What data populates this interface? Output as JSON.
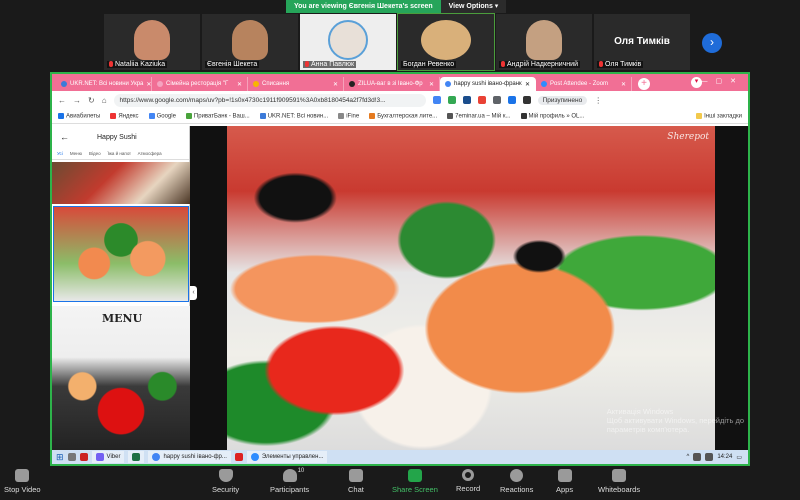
{
  "zoom_banner": {
    "viewing_text": "You are viewing Євгенія Шекета's screen",
    "view_options": "View Options ▾"
  },
  "participants": [
    {
      "name": "Nataliia Kaziuka",
      "muted": true,
      "face_color": "#c98a6b"
    },
    {
      "name": "Євгенія Шекета",
      "muted": false,
      "face_color": "#b7835e"
    },
    {
      "name": "Анна Павлюк",
      "muted": true,
      "face_color": "#e8e0d8"
    },
    {
      "name": "Богдан Ревенко",
      "muted": false,
      "face_color": "#d9b07a",
      "active": true
    },
    {
      "name": "Андрій Надкерничний",
      "muted": true,
      "face_color": "#c4a081"
    },
    {
      "name": "Оля Тимків",
      "muted": true,
      "big_name": "Оля Тимків"
    }
  ],
  "browser": {
    "tabs": [
      {
        "title": "UKR.NET: Всі новини Укра",
        "fav": "#3c7bd9"
      },
      {
        "title": "Сімейна ресторація \"Г",
        "fav": "#f5a3c0"
      },
      {
        "title": "Списання",
        "fav": "#f7b500"
      },
      {
        "title": "ZILUA-ваг в зі Івано-Фр",
        "fav": "#222222"
      },
      {
        "title": "happy sushi івано-франк",
        "fav": "#4285f4",
        "active": true
      },
      {
        "title": "Post Attendee - Zoom",
        "fav": "#2d8cff"
      }
    ],
    "address": "https://www.google.com/maps/uv?pb=!1s0x4730c1911f909591%3A0xb8180454a2f7fd3d!3...",
    "paused_label": "Призупинено",
    "bookmarks": [
      {
        "label": "Авиабилеты",
        "color": "#1a73e8"
      },
      {
        "label": "Яндекс",
        "color": "#e33"
      },
      {
        "label": "Google",
        "color": "#4285f4"
      },
      {
        "label": "ПриватБанк - Ваш...",
        "color": "#49a33b"
      },
      {
        "label": "UKR.NET: Всі новин...",
        "color": "#3c7bd9"
      },
      {
        "label": "iFine",
        "color": "#888"
      },
      {
        "label": "Бухгалтерская лите...",
        "color": "#e57b20"
      },
      {
        "label": "7eminar.ua – Мій к...",
        "color": "#555"
      },
      {
        "label": "Мій профиль » OL...",
        "color": "#333"
      }
    ],
    "other_bookmarks": "Інші закладки"
  },
  "maps_panel": {
    "title": "Happy Sushi",
    "tabs": [
      "Усі",
      "Меню",
      "Відео",
      "Їжа й напої",
      "Атмосфера"
    ],
    "menu_word": "MENU"
  },
  "photo": {
    "watermark": "Sherepot",
    "activate_line1": "Активація Windows",
    "activate_line2": "Щоб активувати Windows, перейдіть до",
    "activate_line3": "параметрів комп'ютера."
  },
  "taskbar": {
    "items": [
      {
        "label": "Viber",
        "color": "#7360f2"
      },
      {
        "label": "",
        "color": "#1e7145"
      },
      {
        "label": "happy sushi івано-фр...",
        "color": "#4285f4"
      },
      {
        "label": "Элементы управлен...",
        "color": "#2d8cff"
      }
    ],
    "time": "14:24"
  },
  "controls": {
    "stop_video": "Stop Video",
    "security": "Security",
    "participants": "Participants",
    "participants_count": "10",
    "chat": "Chat",
    "share_screen": "Share Screen",
    "record": "Record",
    "reactions": "Reactions",
    "apps": "Apps",
    "whiteboards": "Whiteboards"
  }
}
